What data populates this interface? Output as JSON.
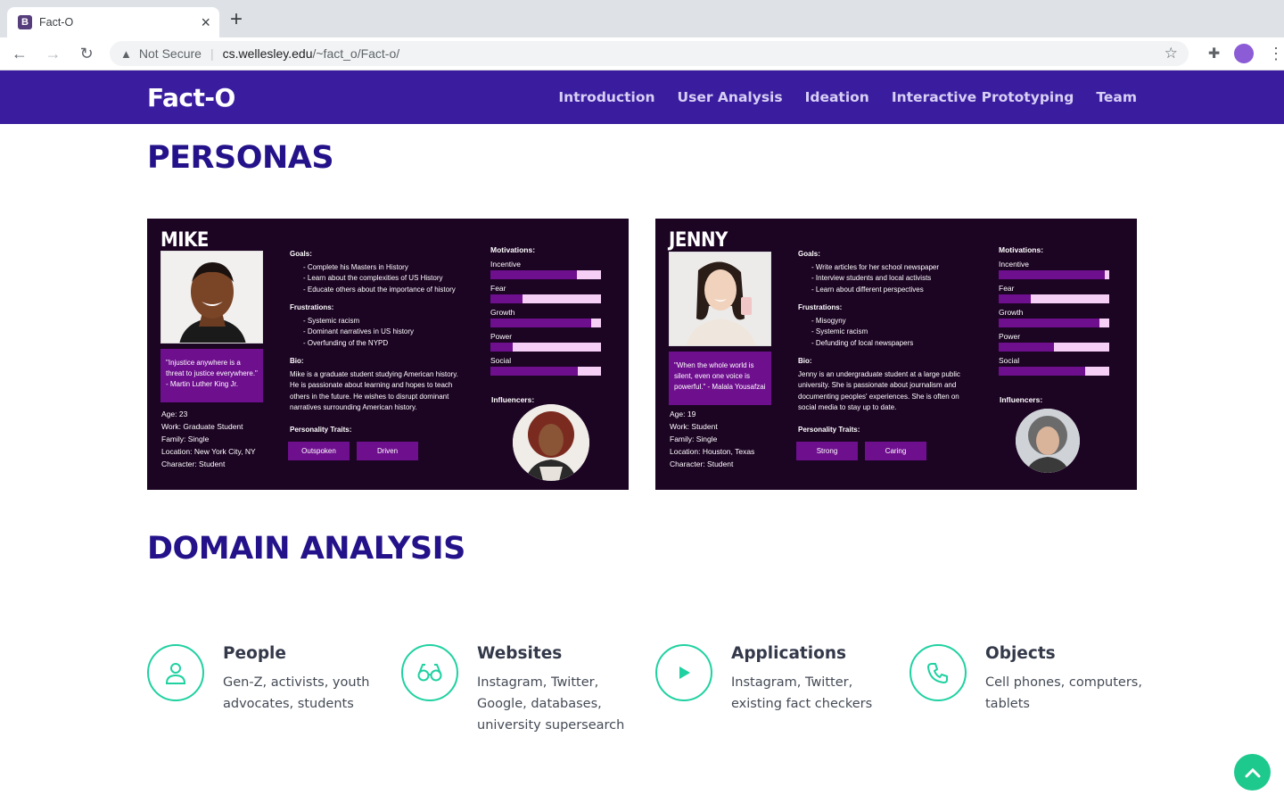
{
  "browser": {
    "tab_title": "Fact-O",
    "favicon_letter": "B",
    "address": {
      "security_label": "Not Secure",
      "url_host": "cs.wellesley.edu",
      "url_path": "/~fact_o/Fact-o/"
    }
  },
  "site": {
    "brand": "Fact-O",
    "nav": [
      "Introduction",
      "User Analysis",
      "Ideation",
      "Interactive Prototyping",
      "Team"
    ]
  },
  "personas_section": {
    "title": "PERSONAS",
    "personas": [
      {
        "name": "MIKE",
        "quote": "\"Injustice anywhere is a threat to justice everywhere.\" - Martin Luther King Jr.",
        "facts": [
          "Age: 23",
          "Work: Graduate Student",
          "Family: Single",
          "Location: New York City, NY",
          "Character: Student"
        ],
        "goals_label": "Goals:",
        "goals": [
          "Complete his Masters in History",
          "Learn about the complexities of US History",
          "Educate others about the importance of history"
        ],
        "frustrations_label": "Frustrations:",
        "frustrations": [
          "Systemic racism",
          "Dominant narratives in US history",
          "Overfunding of the NYPD"
        ],
        "bio_label": "Bio:",
        "bio": "Mike is a graduate student studying American history. He is passionate about learning and hopes to teach others in the future. He wishes to disrupt dominant narratives surrounding American history.",
        "traits_label": "Personality Traits:",
        "traits": [
          "Outspoken",
          "Driven"
        ],
        "motivations_label": "Motivations:",
        "motivations": [
          {
            "label": "Incentive",
            "level": 0.78
          },
          {
            "label": "Fear",
            "level": 0.29
          },
          {
            "label": "Growth",
            "level": 0.91
          },
          {
            "label": "Power",
            "level": 0.2
          },
          {
            "label": "Social",
            "level": 0.79
          }
        ],
        "influencers_label": "Influencers:"
      },
      {
        "name": "JENNY",
        "quote": "\"When the whole world is silent, even one voice is powerful.\" - Malala Yousafzai",
        "facts": [
          "Age: 19",
          "Work: Student",
          "Family: Single",
          "Location: Houston, Texas",
          "Character: Student"
        ],
        "goals_label": "Goals:",
        "goals": [
          "Write articles for her school newspaper",
          "Interview students and local activists",
          "Learn about different perspectives"
        ],
        "frustrations_label": "Frustrations:",
        "frustrations": [
          "Misogyny",
          "Systemic racism",
          "Defunding of local newspapers"
        ],
        "bio_label": "Bio:",
        "bio": "Jenny is an undergraduate student at a large public university. She is passionate about journalism and documenting peoples' experiences. She is often on social media to stay up to date.",
        "traits_label": "Personality Traits:",
        "traits": [
          "Strong",
          "Caring"
        ],
        "motivations_label": "Motivations:",
        "motivations": [
          {
            "label": "Incentive",
            "level": 0.96
          },
          {
            "label": "Fear",
            "level": 0.29
          },
          {
            "label": "Growth",
            "level": 0.91
          },
          {
            "label": "Power",
            "level": 0.5
          },
          {
            "label": "Social",
            "level": 0.78
          }
        ],
        "influencers_label": "Influencers:"
      }
    ]
  },
  "domain_section": {
    "title": "DOMAIN ANALYSIS",
    "items": [
      {
        "icon": "person-icon",
        "title": "People",
        "desc": "Gen-Z, activists, youth advocates, students"
      },
      {
        "icon": "glasses-icon",
        "title": "Websites",
        "desc": "Instagram, Twitter, Google, databases, university supersearch"
      },
      {
        "icon": "play-icon",
        "title": "Applications",
        "desc": "Instagram, Twitter, existing fact checkers"
      },
      {
        "icon": "phone-icon",
        "title": "Objects",
        "desc": "Cell phones, computers, tablets"
      }
    ]
  },
  "colors": {
    "nav_bg": "#3a1d9e",
    "heading": "#24128a",
    "persona_bg": "#1c0423",
    "persona_accent": "#6e0f8e",
    "bar_empty": "#f5cff5",
    "teal": "#1fd1a1"
  }
}
